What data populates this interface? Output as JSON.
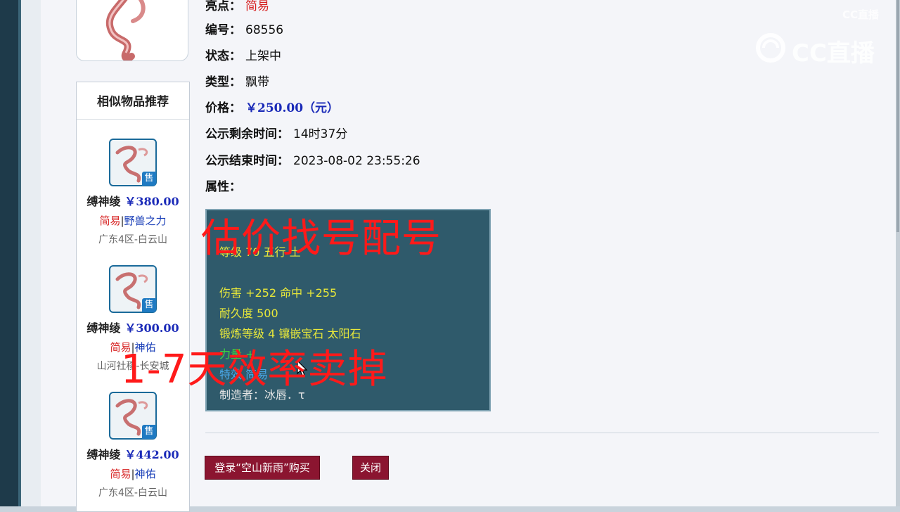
{
  "item": {
    "highlight_label": "亮点：",
    "highlight_value": "简易",
    "number_label": "编号：",
    "number_value": "68556",
    "status_label": "状态：",
    "status_value": "上架中",
    "type_label": "类型：",
    "type_value": "飘带",
    "price_label": "价格：",
    "price_value": "￥250.00（元）",
    "remain_label": "公示剩余时间：",
    "remain_value": "14时37分",
    "end_label": "公示结束时间：",
    "end_value": "2023-08-02 23:55:26",
    "attributes_label": "属性："
  },
  "attributes": {
    "level": "等级 70 五行 土",
    "damage": "伤害 +252 命中 +255",
    "durability": "耐久度 500",
    "forge": "锻炼等级 4 镶嵌宝石 太阳石",
    "bonus": "力量 +",
    "special": "特效 简易",
    "maker": "制造者：冰唇．τ"
  },
  "recommend": {
    "title": "相似物品推荐",
    "sale_badge": "售",
    "items": [
      {
        "name": "缚神绫",
        "price": "￥380.00",
        "tag": "简易",
        "attr": "野兽之力",
        "server": "广东4区-白云山"
      },
      {
        "name": "缚神绫",
        "price": "￥300.00",
        "tag": "简易",
        "attr": "神佑",
        "server": "山河社稷-长安城"
      },
      {
        "name": "缚神绫",
        "price": "￥442.00",
        "tag": "简易",
        "attr": "神佑",
        "server": "广东4区-白云山"
      }
    ]
  },
  "buttons": {
    "login_buy": "登录“空山新雨”购买",
    "close": "关闭"
  },
  "overlay": {
    "line1": "估价找号配号",
    "line2": "1-7天效率卖掉"
  },
  "watermark": {
    "small": "CC直播",
    "big": "CC直播"
  },
  "colors": {
    "price_blue": "#1a2ab8",
    "tag_red": "#d62020",
    "attr_box_bg": "#2f5a6b",
    "attr_text_yellow": "#e8e83a",
    "button_maroon": "#8b1530",
    "overlay_red": "#ff1a1a"
  }
}
